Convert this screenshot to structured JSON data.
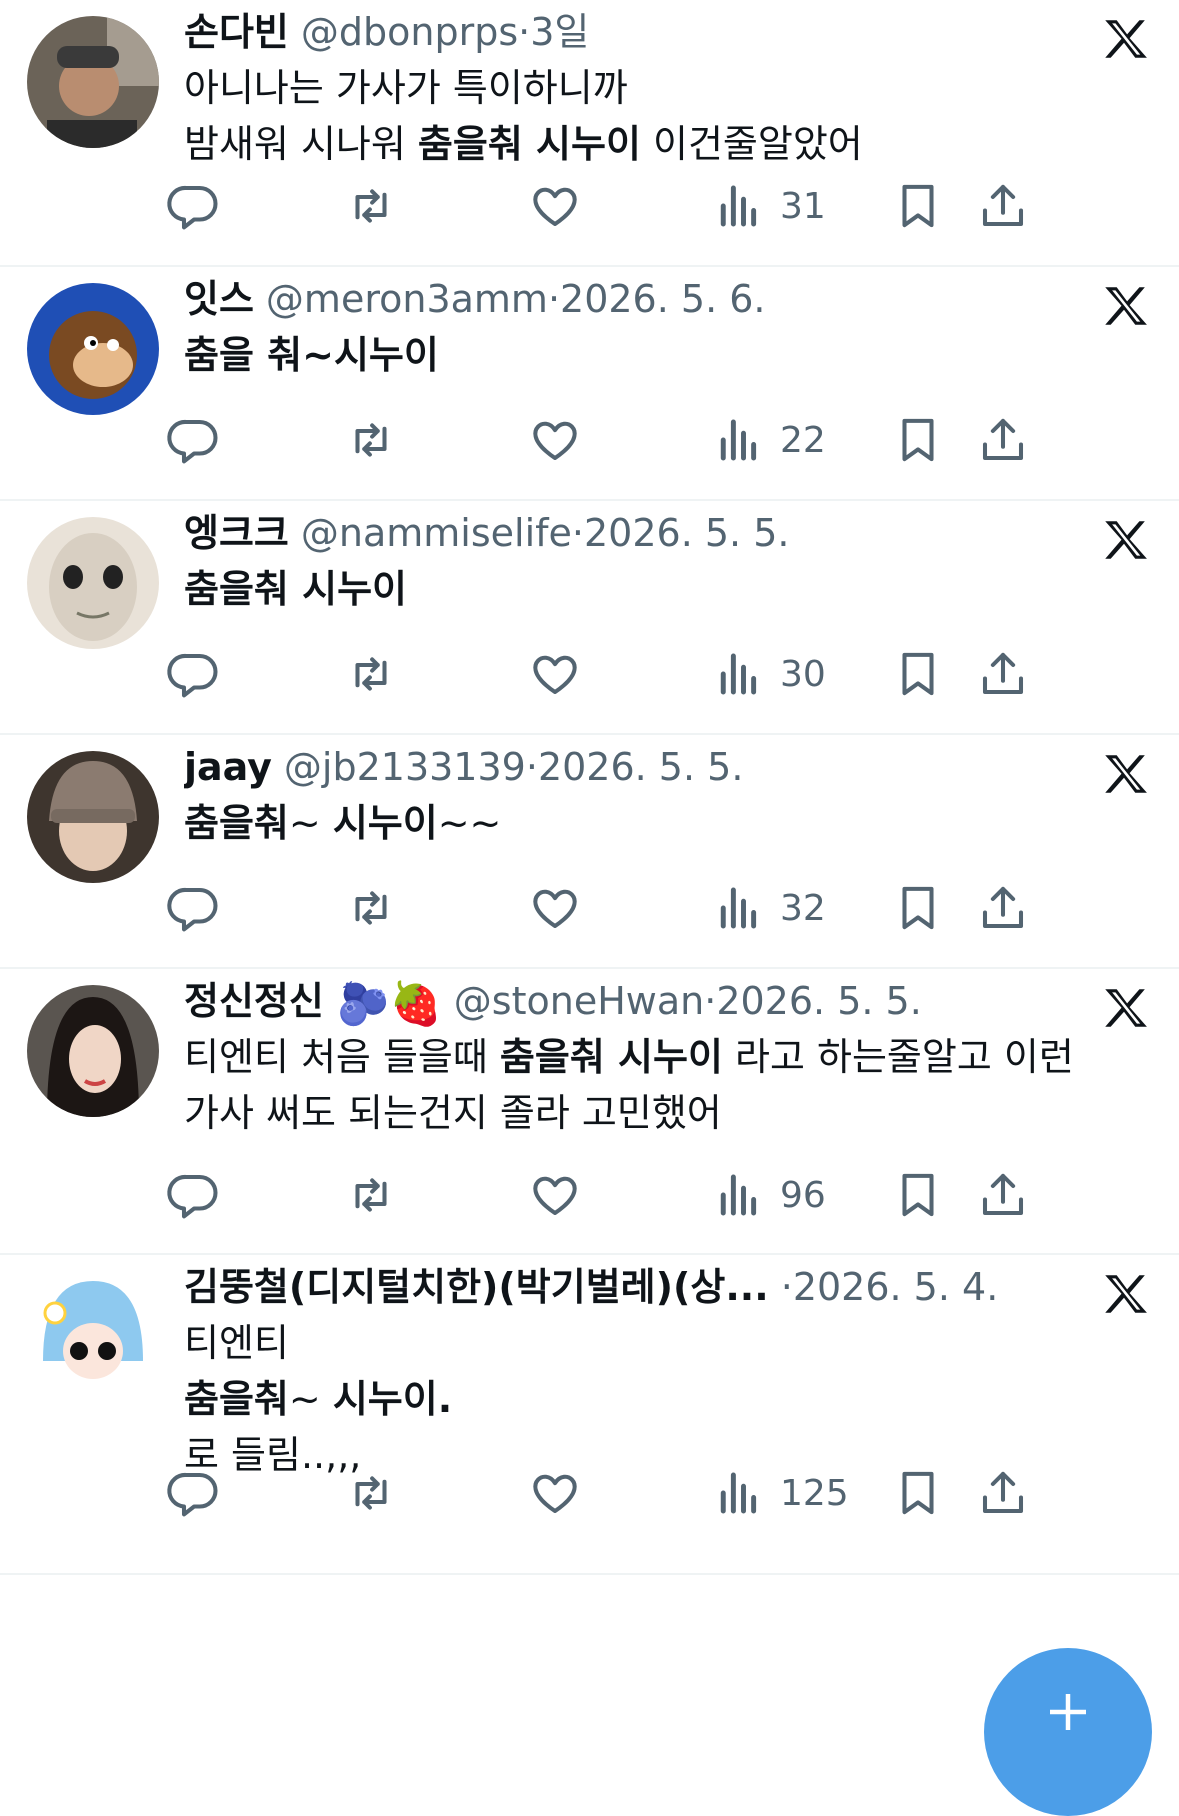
{
  "tweets": [
    {
      "name": "손다빈",
      "handle": "@dbonprps",
      "sep": "·",
      "date": "3일",
      "lines": [
        [
          {
            "t": "아니나는 가사가 특이하니까",
            "b": false
          }
        ],
        [
          {
            "t": "밤새워 시나워 ",
            "b": false
          },
          {
            "t": "춤을춰 시누이",
            "b": true
          },
          {
            "t": " 이건줄알았어",
            "b": false
          }
        ]
      ],
      "views": "31",
      "avatar": "man-dark"
    },
    {
      "name": "잇스",
      "handle": "@meron3amm",
      "sep": "·",
      "date": "2026. 5. 6.",
      "lines": [
        [
          {
            "t": "춤을 춰~시누이",
            "b": true
          }
        ]
      ],
      "views": "22",
      "avatar": "monkey"
    },
    {
      "name": "엥크크",
      "handle": "@nammiselife",
      "sep": "·",
      "date": "2026. 5. 5.",
      "lines": [
        [
          {
            "t": "춤을춰 시누이",
            "b": true
          }
        ]
      ],
      "views": "30",
      "avatar": "mask-face"
    },
    {
      "name": "jaay",
      "handle": "@jb2133139",
      "sep": "·",
      "date": "2026. 5. 5.",
      "lines": [
        [
          {
            "t": "춤을춰",
            "b": true
          },
          {
            "t": "~ ",
            "b": false
          },
          {
            "t": "시누이",
            "b": true
          },
          {
            "t": "~~",
            "b": false
          }
        ]
      ],
      "views": "32",
      "avatar": "girl-beanie"
    },
    {
      "name": "정신정신",
      "emoji": "🫐🍓",
      "handle": "@stoneHwan",
      "sep": "·",
      "date": "2026. 5. 5.",
      "lines": [
        [
          {
            "t": "티엔티 처음 들을때 ",
            "b": false
          },
          {
            "t": "춤을춰 시누이",
            "b": true
          },
          {
            "t": " 라고 하는줄알고 이런",
            "b": false
          }
        ],
        [
          {
            "t": "가사 써도 되는건지 졸라 고민했어",
            "b": false
          }
        ]
      ],
      "views": "96",
      "avatar": "woman-dark-hair"
    },
    {
      "name": "김뚱철(디지털치한)(박기벌레)(상...",
      "handle": "",
      "sep": "·",
      "date": "2026. 5. 4.",
      "lines": [
        [
          {
            "t": "티엔티",
            "b": false
          }
        ],
        [
          {
            "t": "춤을춰",
            "b": true
          },
          {
            "t": "~ ",
            "b": false
          },
          {
            "t": "시누이.",
            "b": true
          }
        ],
        [
          {
            "t": "로 들림..,,,",
            "b": false
          }
        ]
      ],
      "views": "125",
      "avatar": "anime-blue-hair"
    }
  ],
  "icons": {
    "reply": "reply-icon",
    "retweet": "retweet-icon",
    "like": "like-icon",
    "views": "views-icon",
    "bookmark": "bookmark-icon",
    "share": "share-icon",
    "platform": "x-logo-icon",
    "compose": "plus-icon"
  },
  "colors": {
    "text": "#0f1419",
    "secondary": "#536471",
    "accent": "#4c9ee8",
    "divider": "#eff3f4"
  }
}
